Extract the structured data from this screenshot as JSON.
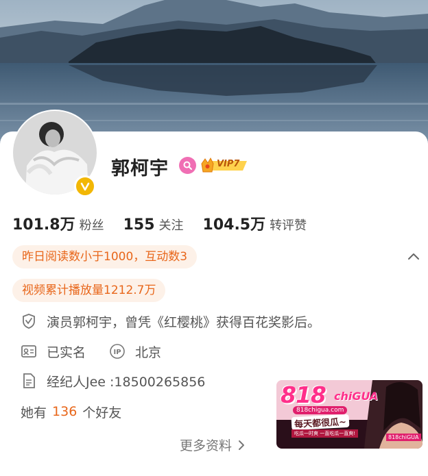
{
  "profile": {
    "name": "郭柯宇",
    "vip_level": "VIP7"
  },
  "stats": {
    "followers": {
      "value": "101.8万",
      "label": "粉丝"
    },
    "following": {
      "value": "155",
      "label": "关注"
    },
    "interactions": {
      "value": "104.5万",
      "label": "转评赞"
    }
  },
  "highlights": {
    "reads_yesterday": "昨日阅读数小于1000，互动数3",
    "video_plays": "视频累计播放量1212.7万"
  },
  "info": {
    "bio": "演员郭柯宇，曾凭《红樱桃》获得百花奖影后。",
    "verification": "已实名",
    "ip_badge": "IP",
    "ip_location": "北京",
    "agent": "经纪人Jee :18500265856",
    "friends_prefix": "她有",
    "friends_count": "136",
    "friends_suffix": "个好友",
    "more_link": "更多资料"
  },
  "ad": {
    "logo_number": "818",
    "logo_word": "chiGUA",
    "url": "818chigua.com",
    "slogan": "每天都很瓜~",
    "sub": "吃瓜一时爽 一直吃瓜一直爽!",
    "brand": "818chiGUA"
  },
  "colors": {
    "accent_orange": "#e8661a",
    "pill_bg": "#fdf1e8",
    "verify_gold": "#f2b705",
    "member_pink": "#f06fb4"
  },
  "icons": [
    "shield-icon",
    "id-card-icon",
    "ip-icon",
    "document-icon",
    "chevron-up-icon",
    "chevron-right-icon",
    "verified-badge-icon",
    "member-icon",
    "vip-crown-icon"
  ]
}
